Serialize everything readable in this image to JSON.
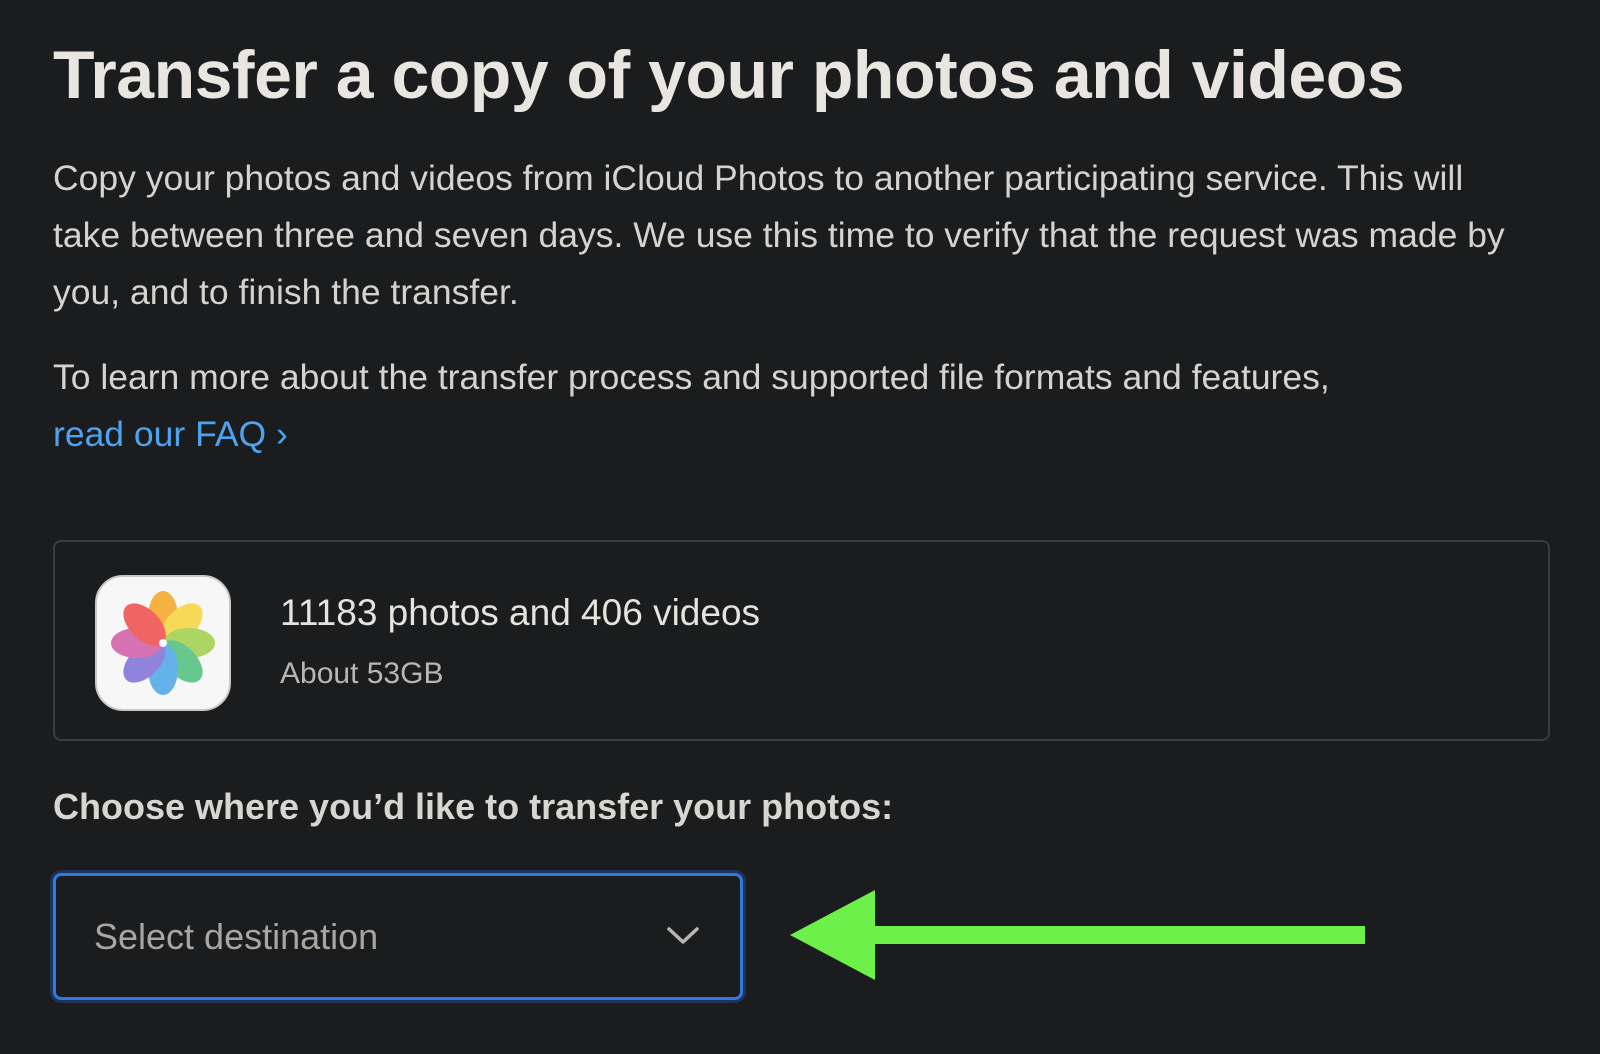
{
  "page": {
    "title": "Transfer a copy of your photos and videos",
    "intro": "Copy your photos and videos from iCloud Photos to another participating service. This will take between three and seven days. We use this time to verify that the request was made by you, and to finish the transfer.",
    "learn_more_prefix": "To learn more about the transfer process and supported file formats and features,",
    "faq_link": "read our FAQ ›"
  },
  "summary": {
    "icon": "photos-app-icon",
    "counts": "11183 photos and 406 videos",
    "size": "About 53GB"
  },
  "destination": {
    "label": "Choose where you’d like to transfer your photos:",
    "placeholder": "Select destination",
    "icon": "chevron-down-icon"
  },
  "annotation": {
    "icon": "green-arrow-left-icon",
    "color": "#6ef04b"
  }
}
